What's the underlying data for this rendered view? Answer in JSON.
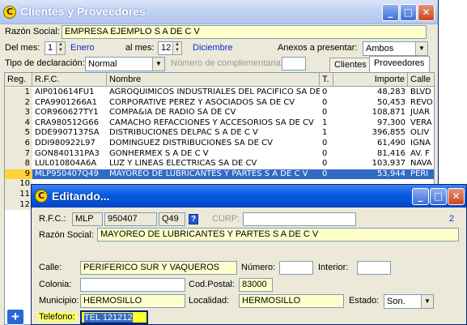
{
  "main_window": {
    "title": "Clientes y Proveedores",
    "razon_social_label": "Razón Social:",
    "razon_social_value": "EMPRESA EJEMPLO  S A  DE C V",
    "del_mes_label": "Del mes:",
    "del_mes_value": "1",
    "del_mes_name": "Enero",
    "al_mes_label": "al mes:",
    "al_mes_value": "12",
    "al_mes_name": "Diciembre",
    "anexos_label": "Anexos a presentar:",
    "anexos_value": "Ambos",
    "tipo_decl_label": "Tipo de declaración:",
    "tipo_decl_value": "Normal",
    "num_compl_label": "Número de complementaria:",
    "num_compl_value": "",
    "tabs": [
      {
        "label": "Clientes",
        "active": false
      },
      {
        "label": "Proveedores",
        "active": true
      }
    ],
    "grid": {
      "headers": [
        "Reg.",
        "R.F.C.",
        "Nombre",
        "T.",
        "Importe",
        "Calle"
      ],
      "rows": [
        {
          "reg": "1",
          "rfc": "AIP010614FU1",
          "nombre": "AGROQUIMICOS INDUSTRIALES DEL PACIFICO SA DE",
          "t": "0",
          "importe": "48,283",
          "calle": "BLVD"
        },
        {
          "reg": "2",
          "rfc": "CPA9901266A1",
          "nombre": "CORPORATIVE PEREZ Y ASOCIADOS SA DE CV",
          "t": "0",
          "importe": "50,453",
          "calle": "REVO"
        },
        {
          "reg": "3",
          "rfc": "COR960627TY1",
          "nombre": "COMPA&IA DE RADIO SA DE CV",
          "t": "0",
          "importe": "108,871",
          "calle": "JUAR"
        },
        {
          "reg": "4",
          "rfc": "CRA980512G66",
          "nombre": "CAMACHO REFACCIONES Y ACCESORIOS SA DE CV",
          "t": "1",
          "importe": "97,300",
          "calle": "VERA"
        },
        {
          "reg": "5",
          "rfc": "DDE9907137SA",
          "nombre": "DISTRIBUCIONES DELPAC S A DE C V",
          "t": "1",
          "importe": "396,855",
          "calle": "OLIV"
        },
        {
          "reg": "6",
          "rfc": "DDI980922L97",
          "nombre": "DOMINGUEZ DISTRIBUCIONES SA DE CV",
          "t": "0",
          "importe": "61,490",
          "calle": "IGNA"
        },
        {
          "reg": "7",
          "rfc": "GON840131PA3",
          "nombre": "GONHERMEX  S A  DE C V",
          "t": "0",
          "importe": "81,416",
          "calle": "AV. F"
        },
        {
          "reg": "8",
          "rfc": "LUL010804A6A",
          "nombre": "LUZ Y LINEAS ELECTRICAS SA DE CV",
          "t": "0",
          "importe": "103,937",
          "calle": "NAVA"
        },
        {
          "reg": "9",
          "rfc": "MLP950407Q49",
          "nombre": "MAYOREO DE LUBRICANTES Y PARTES  S A  DE C V",
          "t": "0",
          "importe": "53,944",
          "calle": "PERI",
          "selected": true
        },
        {
          "reg": "10",
          "rfc": "",
          "nombre": "",
          "t": "",
          "importe": "",
          "calle": ""
        },
        {
          "reg": "11",
          "rfc": "",
          "nombre": "",
          "t": "",
          "importe": "",
          "calle": ""
        },
        {
          "reg": "12",
          "rfc": "",
          "nombre": "",
          "t": "",
          "importe": "",
          "calle": ""
        }
      ]
    },
    "add_button": "+"
  },
  "edit_dialog": {
    "title": "Editando...",
    "rfc_label": "R.F.C.:",
    "rfc_part1": "MLP",
    "rfc_part2": "950407",
    "rfc_part3": "Q49",
    "help_label": "?",
    "curp_label": "CURP:",
    "curp_value": "",
    "record_number": "2",
    "razon_social_label": "Razón Social:",
    "razon_social_value": "MAYOREO DE LUBRICANTES Y PARTES  S A  DE C V",
    "calle_label": "Calle:",
    "calle_value": "PERIFERICO SUR Y VAQUEROS",
    "numero_label": "Número:",
    "numero_value": "",
    "interior_label": "Interior:",
    "interior_value": "",
    "colonia_label": "Colonia:",
    "colonia_value": "",
    "cp_label": "Cod.Postal:",
    "cp_value": "83000",
    "municipio_label": "Municipio:",
    "municipio_value": "HERMOSILLO",
    "localidad_label": "Localidad:",
    "localidad_value": "HERMOSILLO",
    "estado_label": "Estado:",
    "estado_value": "Son.",
    "telefono_label": "Telefono:",
    "telefono_value": "TEL 121212"
  },
  "colors": {
    "selection": "#316ac5",
    "yellow_field": "#ffffcc",
    "title_active": "#0a5ae0"
  }
}
